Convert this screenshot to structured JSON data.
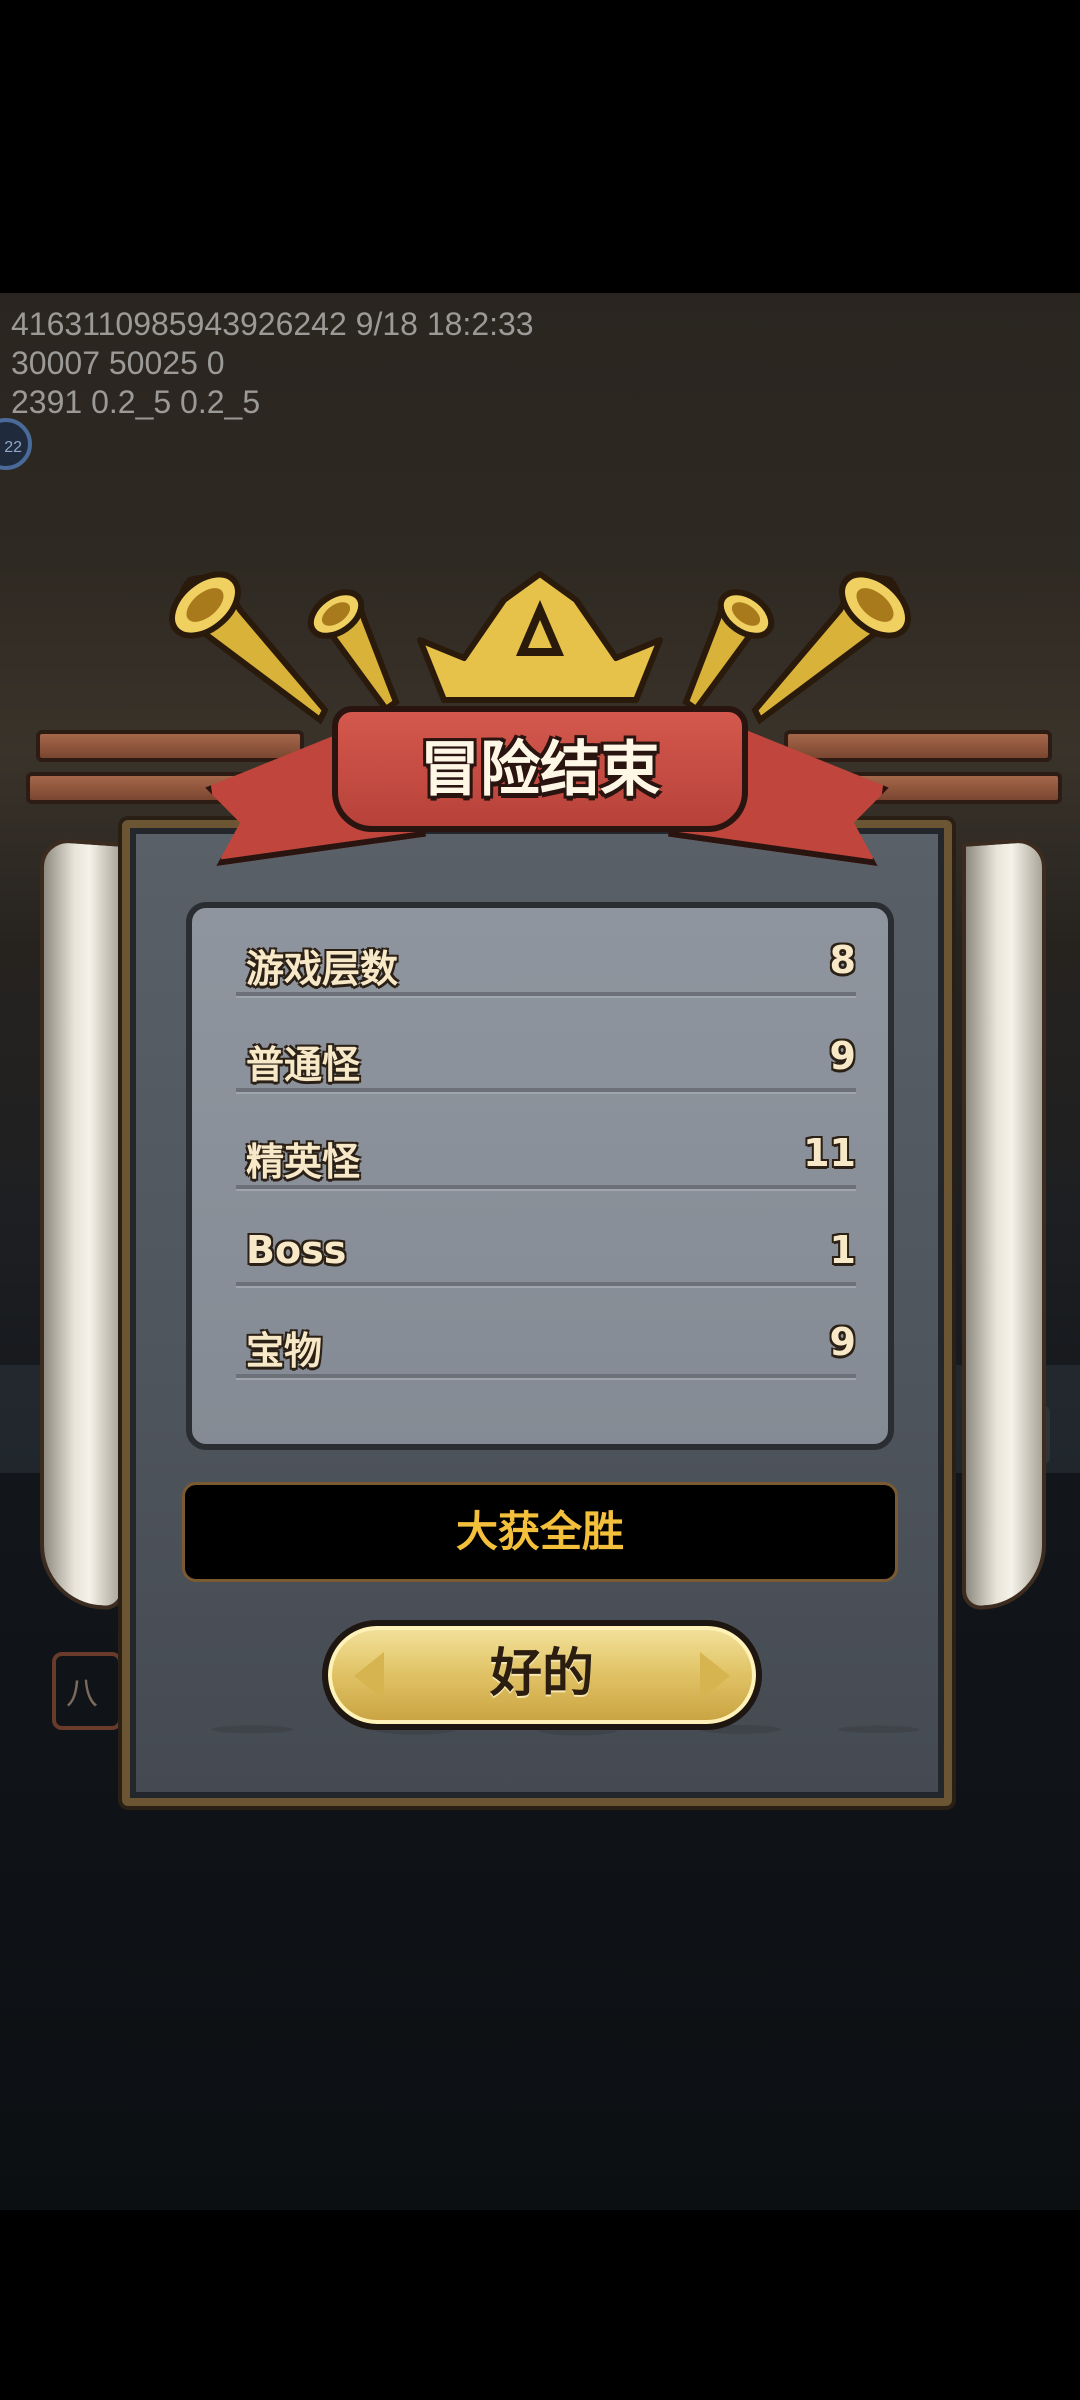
{
  "debug_lines": [
    "4163110985943926242 9/18 18:2:33",
    "30007 50025 0",
    "2391 0.2_5 0.2_5"
  ],
  "background": {
    "badge_text": "22",
    "badge2_text": "22",
    "tag_text": "八"
  },
  "dialog": {
    "title": "冒险结束",
    "stats": [
      {
        "label": "游戏层数",
        "value": "8"
      },
      {
        "label": "普通怪",
        "value": "9"
      },
      {
        "label": "精英怪",
        "value": "11"
      },
      {
        "label": "Boss",
        "value": "1"
      },
      {
        "label": "宝物",
        "value": "9"
      }
    ],
    "result_text": "大获全胜",
    "ok_label": "好的"
  },
  "colors": {
    "result_text": "#f4bf3a",
    "ribbon": "#c0453c",
    "gold": "#e2c569",
    "panel": "#8f959e"
  }
}
